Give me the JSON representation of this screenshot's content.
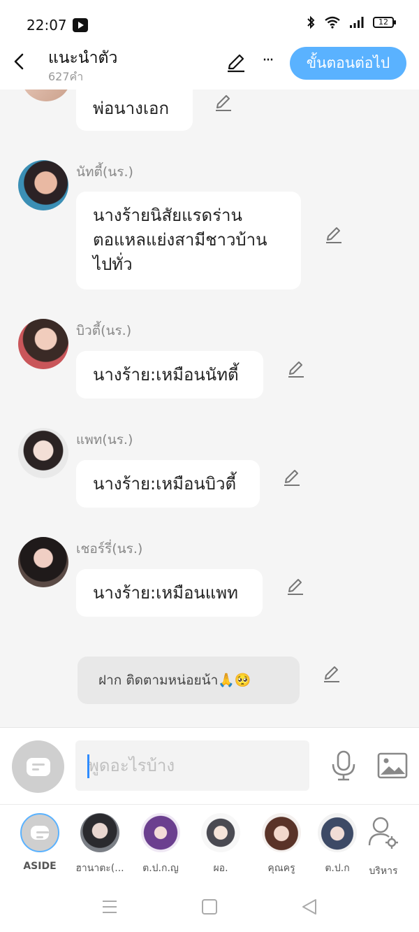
{
  "status_bar": {
    "time": "22:07",
    "battery": "12"
  },
  "header": {
    "title": "แนะนำตัว",
    "word_count": "627คำ",
    "more_label": "···",
    "next_button": "ขั้นตอนต่อไป"
  },
  "messages": [
    {
      "speaker": "",
      "text": "พ่อนางเอก"
    },
    {
      "speaker": "นัทตี้(นร.)",
      "lines": [
        "นางร้ายนิสัยแรดร่าน",
        "ตอแหลแย่งสามีชาวบ้าน",
        "ไปทั่ว"
      ]
    },
    {
      "speaker": "บิวตี้(นร.)",
      "text": "นางร้าย:เหมือนนัทตี้"
    },
    {
      "speaker": "แพท(นร.)",
      "text": "นางร้าย:เหมือนบิวตี้"
    },
    {
      "speaker": "เชอร์รี่(นร.)",
      "text": "นางร้าย:เหมือนแพท"
    }
  ],
  "aside_message": {
    "text": "ฝาก ติดตามหน่อยน้า🙏🥺"
  },
  "input": {
    "placeholder": "พูดอะไรบ้าง"
  },
  "characters": [
    {
      "label": "ASIDE"
    },
    {
      "label": "ฮานาตะ(..."
    },
    {
      "label": "ต.ป.ก.ญ"
    },
    {
      "label": "ผอ."
    },
    {
      "label": "คุณครู"
    },
    {
      "label": "ต.ป.ก"
    },
    {
      "label": "บริหาร"
    }
  ],
  "colors": {
    "accent": "#5ab2ff",
    "background": "#f5f5f5",
    "bubble": "#ffffff"
  }
}
